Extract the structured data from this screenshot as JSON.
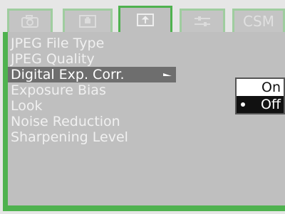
{
  "tabs": [
    {
      "icon": "camera-icon"
    },
    {
      "icon": "camera-settings-icon"
    },
    {
      "icon": "custom-shooting-icon",
      "active": true
    },
    {
      "icon": "sliders-icon"
    },
    {
      "label": "CSM"
    }
  ],
  "menu": {
    "items": [
      {
        "label": "JPEG File Type"
      },
      {
        "label": "JPEG Quality"
      },
      {
        "label": "Digital Exp. Corr.",
        "selected": true
      },
      {
        "label": "Exposure Bias"
      },
      {
        "label": "Look"
      },
      {
        "label": "Noise Reduction"
      },
      {
        "label": "Sharpening Level"
      }
    ]
  },
  "submenu": {
    "options": [
      {
        "label": "On"
      },
      {
        "label": "Off",
        "checked": true
      }
    ]
  },
  "colors": {
    "accent_green": "#4fb24f",
    "panel_gray": "#bfbfbf",
    "selected_gray": "#6e6e6e"
  }
}
